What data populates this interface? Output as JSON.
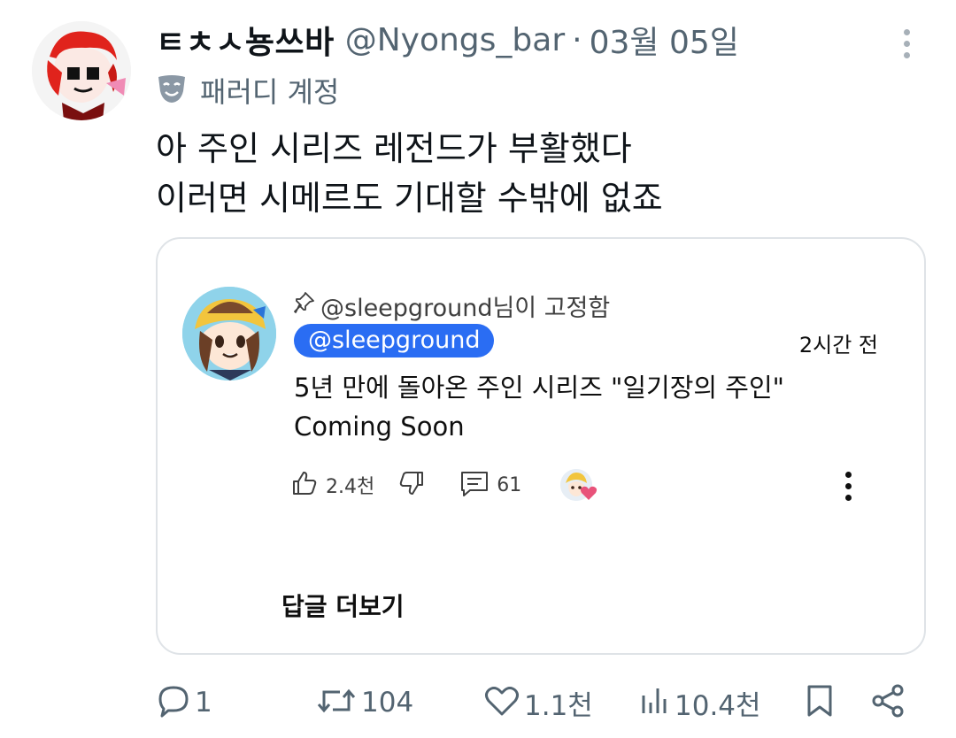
{
  "tweet": {
    "display_name": "ㅌㅊㅅ뇽쓰바",
    "handle": "@Nyongs_bar",
    "separator": "·",
    "date": "03월 05일",
    "account_label": "패러디 계정",
    "text_lines": [
      "아 주인 시리즈 레전드가 부활했다",
      "이러면 시메르도 기대할 수밖에 없죠"
    ]
  },
  "embedded_comment": {
    "pinned_text": "@sleepground님이 고정함",
    "author_chip": "@sleepground",
    "time_ago": "2시간 전",
    "text_lines": [
      "5년 만에 돌아온 주인 시리즈 \"일기장의 주인\"",
      "Coming Soon"
    ],
    "like_count": "2.4천",
    "reply_count": "61",
    "more_replies_label": "답글 더보기"
  },
  "stats": {
    "replies": "1",
    "retweets": "104",
    "likes": "1.1천",
    "views": "10.4천"
  },
  "icons": {
    "more": "more-vertical-icon",
    "parody": "theater-mask-icon",
    "pin": "pin-icon",
    "like": "thumbs-up-icon",
    "dislike": "thumbs-down-icon",
    "comment": "comment-icon",
    "reply": "reply-icon",
    "retweet": "retweet-icon",
    "heart": "heart-icon",
    "views": "bar-chart-icon",
    "bookmark": "bookmark-icon",
    "share": "share-icon"
  },
  "colors": {
    "chip_blue": "#2a6df3",
    "muted_text": "#536471",
    "heart_badge": "#e8527a"
  }
}
